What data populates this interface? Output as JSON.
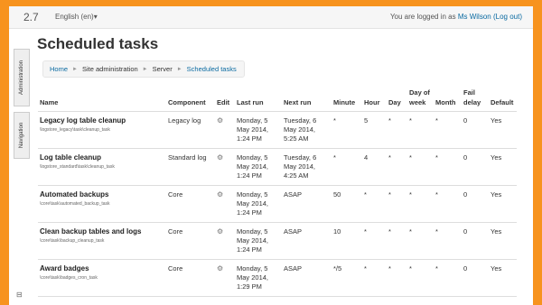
{
  "navbar": {
    "brand": "2.7",
    "language": "English (en)",
    "logged_in_prefix": "You are logged in as",
    "user_name": "Ms Wilson",
    "logout": "(Log out)"
  },
  "sidebar": {
    "administration_tab": "Administration",
    "navigation_tab": "Navigation"
  },
  "page": {
    "title": "Scheduled tasks"
  },
  "breadcrumb": [
    "Home",
    "Site administration",
    "Server",
    "Scheduled tasks"
  ],
  "table": {
    "headers": {
      "name": "Name",
      "component": "Component",
      "edit": "Edit",
      "last_run": "Last run",
      "next_run": "Next run",
      "minute": "Minute",
      "hour": "Hour",
      "day": "Day",
      "day_of_week": "Day of week",
      "month": "Month",
      "fail_delay": "Fail delay",
      "default": "Default"
    },
    "rows": [
      {
        "name": "Legacy log table cleanup",
        "path": "\\logstore_legacy\\task\\cleanup_task",
        "component": "Legacy log",
        "last_run": "Monday, 5 May 2014, 1:24 PM",
        "next_run": "Tuesday, 6 May 2014, 5:25 AM",
        "minute": "*",
        "hour": "5",
        "day": "*",
        "day_of_week": "*",
        "month": "*",
        "fail_delay": "0",
        "default": "Yes"
      },
      {
        "name": "Log table cleanup",
        "path": "\\logstore_standard\\task\\cleanup_task",
        "component": "Standard log",
        "last_run": "Monday, 5 May 2014, 1:24 PM",
        "next_run": "Tuesday, 6 May 2014, 4:25 AM",
        "minute": "*",
        "hour": "4",
        "day": "*",
        "day_of_week": "*",
        "month": "*",
        "fail_delay": "0",
        "default": "Yes"
      },
      {
        "name": "Automated backups",
        "path": "\\core\\task\\automated_backup_task",
        "component": "Core",
        "last_run": "Monday, 5 May 2014, 1:24 PM",
        "next_run": "ASAP",
        "minute": "50",
        "hour": "*",
        "day": "*",
        "day_of_week": "*",
        "month": "*",
        "fail_delay": "0",
        "default": "Yes"
      },
      {
        "name": "Clean backup tables and logs",
        "path": "\\core\\task\\backup_cleanup_task",
        "component": "Core",
        "last_run": "Monday, 5 May 2014, 1:24 PM",
        "next_run": "ASAP",
        "minute": "10",
        "hour": "*",
        "day": "*",
        "day_of_week": "*",
        "month": "*",
        "fail_delay": "0",
        "default": "Yes"
      },
      {
        "name": "Award badges",
        "path": "\\core\\task\\badges_cron_task",
        "component": "Core",
        "last_run": "Monday, 5 May 2014, 1:29 PM",
        "next_run": "ASAP",
        "minute": "*/5",
        "hour": "*",
        "day": "*",
        "day_of_week": "*",
        "month": "*",
        "fail_delay": "0",
        "default": "Yes"
      }
    ]
  },
  "icons": {
    "edit": "gear-icon",
    "breadcrumb_separator": "triangle-right-icon",
    "language_caret": "caret-down-icon",
    "dock": "dock-icon"
  },
  "colors": {
    "page_background": "#f7931e",
    "link": "#0a6aa1"
  }
}
